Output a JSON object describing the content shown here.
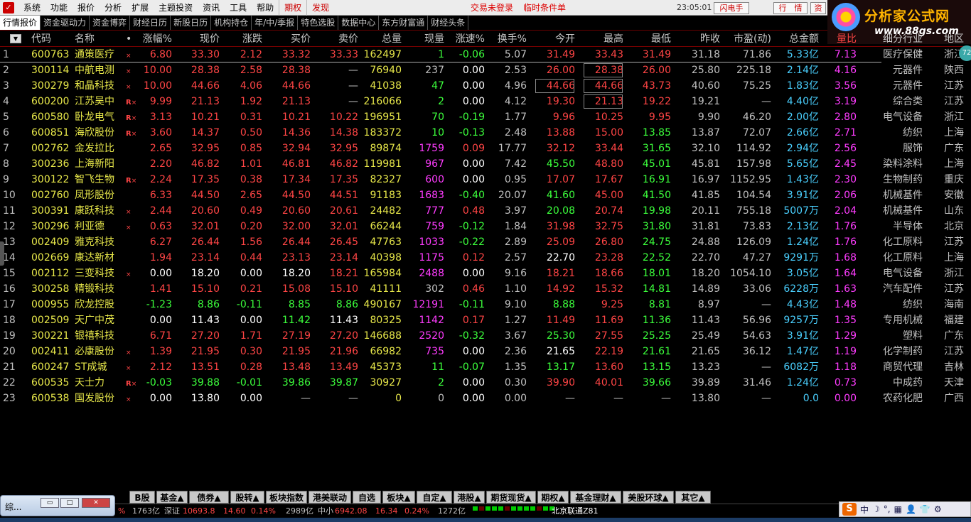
{
  "menubar": {
    "app_icon": "app-logo-icon",
    "items": [
      "系统",
      "功能",
      "报价",
      "分析",
      "扩展",
      "主题投资",
      "资讯",
      "工具",
      "帮助",
      "期权",
      "发现"
    ],
    "accent_items": [
      "期权",
      "发现"
    ],
    "login_status": "交易未登录",
    "conditional_order": "临时条件单",
    "clock": "23:05:01 周五",
    "btn_flash": "闪电手",
    "btn_quote": "行　情",
    "btn_asset": "资"
  },
  "logo": {
    "title": "分析家公式网",
    "url": "www.88gs.com",
    "badge": "72"
  },
  "tabs": [
    "行情报价",
    "资金驱动力",
    "资金博弈",
    "财经日历",
    "新股日历",
    "机构持仓",
    "年/中/季报",
    "特色选股",
    "数据中心",
    "东方财富通",
    "财经头条"
  ],
  "table": {
    "headers": [
      "代码",
      "名称",
      "•",
      "涨幅%",
      "现价",
      "涨跌",
      "买价",
      "卖价",
      "总量",
      "现量",
      "涨速%",
      "换手%",
      "今开",
      "最高",
      "最低",
      "昨收",
      "市盈(动)",
      "总金额",
      "量比",
      "细分行业",
      "地区"
    ],
    "rows": [
      {
        "n": "1",
        "code": "600763",
        "name": "通策医疗",
        "flag": "×",
        "pct": "6.80",
        "price": "33.30",
        "chg": "2.12",
        "bid": "33.32",
        "ask": "33.33",
        "vol": "162497",
        "cur": "1",
        "speed": "-0.06",
        "turn": "5.07",
        "open": "31.49",
        "high": "33.43",
        "low": "31.49",
        "prev": "31.18",
        "pe": "71.86",
        "amt": "5.33亿",
        "ratio": "7.13",
        "ind": "医疗保健",
        "area": "浙江"
      },
      {
        "n": "2",
        "code": "300114",
        "name": "中航电测",
        "flag": "×",
        "pct": "10.00",
        "price": "28.38",
        "chg": "2.58",
        "bid": "28.38",
        "ask": "—",
        "vol": "76940",
        "cur": "237",
        "speed": "0.00",
        "turn": "2.53",
        "open": "26.00",
        "high": "28.38",
        "low": "26.00",
        "prev": "25.80",
        "pe": "225.18",
        "amt": "2.14亿",
        "ratio": "4.16",
        "ind": "元器件",
        "area": "陕西"
      },
      {
        "n": "3",
        "code": "300279",
        "name": "和晶科技",
        "flag": "×",
        "pct": "10.00",
        "price": "44.66",
        "chg": "4.06",
        "bid": "44.66",
        "ask": "—",
        "vol": "41038",
        "cur": "47",
        "speed": "0.00",
        "turn": "4.96",
        "open": "44.66",
        "high": "44.66",
        "low": "43.73",
        "prev": "40.60",
        "pe": "75.25",
        "amt": "1.83亿",
        "ratio": "3.56",
        "ind": "元器件",
        "area": "江苏"
      },
      {
        "n": "4",
        "code": "600200",
        "name": "江苏吴中",
        "flag": "R×",
        "pct": "9.99",
        "price": "21.13",
        "chg": "1.92",
        "bid": "21.13",
        "ask": "—",
        "vol": "216066",
        "cur": "2",
        "speed": "0.00",
        "turn": "4.12",
        "open": "19.30",
        "high": "21.13",
        "low": "19.22",
        "prev": "19.21",
        "pe": "—",
        "amt": "4.40亿",
        "ratio": "3.19",
        "ind": "综合类",
        "area": "江苏"
      },
      {
        "n": "5",
        "code": "600580",
        "name": "卧龙电气",
        "flag": "R×",
        "pct": "3.13",
        "price": "10.21",
        "chg": "0.31",
        "bid": "10.21",
        "ask": "10.22",
        "vol": "196951",
        "cur": "70",
        "speed": "-0.19",
        "turn": "1.77",
        "open": "9.96",
        "high": "10.25",
        "low": "9.95",
        "prev": "9.90",
        "pe": "46.20",
        "amt": "2.00亿",
        "ratio": "2.80",
        "ind": "电气设备",
        "area": "浙江"
      },
      {
        "n": "6",
        "code": "600851",
        "name": "海欣股份",
        "flag": "R×",
        "pct": "3.60",
        "price": "14.37",
        "chg": "0.50",
        "bid": "14.36",
        "ask": "14.38",
        "vol": "183372",
        "cur": "10",
        "speed": "-0.13",
        "turn": "2.48",
        "open": "13.88",
        "high": "15.00",
        "low": "13.85",
        "prev": "13.87",
        "pe": "72.07",
        "amt": "2.66亿",
        "ratio": "2.71",
        "ind": "纺织",
        "area": "上海"
      },
      {
        "n": "7",
        "code": "002762",
        "name": "金发拉比",
        "flag": "",
        "pct": "2.65",
        "price": "32.95",
        "chg": "0.85",
        "bid": "32.94",
        "ask": "32.95",
        "vol": "89874",
        "cur": "1759",
        "speed": "0.09",
        "turn": "17.77",
        "open": "32.12",
        "high": "33.44",
        "low": "31.65",
        "prev": "32.10",
        "pe": "114.92",
        "amt": "2.94亿",
        "ratio": "2.56",
        "ind": "服饰",
        "area": "广东"
      },
      {
        "n": "8",
        "code": "300236",
        "name": "上海新阳",
        "flag": "",
        "pct": "2.20",
        "price": "46.82",
        "chg": "1.01",
        "bid": "46.81",
        "ask": "46.82",
        "vol": "119981",
        "cur": "967",
        "speed": "0.00",
        "turn": "7.42",
        "open": "45.50",
        "high": "48.80",
        "low": "45.01",
        "prev": "45.81",
        "pe": "157.98",
        "amt": "5.65亿",
        "ratio": "2.45",
        "ind": "染料涂料",
        "area": "上海"
      },
      {
        "n": "9",
        "code": "300122",
        "name": "智飞生物",
        "flag": "R×",
        "pct": "2.24",
        "price": "17.35",
        "chg": "0.38",
        "bid": "17.34",
        "ask": "17.35",
        "vol": "82327",
        "cur": "600",
        "speed": "0.00",
        "turn": "0.95",
        "open": "17.07",
        "high": "17.67",
        "low": "16.91",
        "prev": "16.97",
        "pe": "1152.95",
        "amt": "1.43亿",
        "ratio": "2.30",
        "ind": "生物制药",
        "area": "重庆"
      },
      {
        "n": "10",
        "code": "002760",
        "name": "凤形股份",
        "flag": "",
        "pct": "6.33",
        "price": "44.50",
        "chg": "2.65",
        "bid": "44.50",
        "ask": "44.51",
        "vol": "91183",
        "cur": "1683",
        "speed": "-0.40",
        "turn": "20.07",
        "open": "41.60",
        "high": "45.00",
        "low": "41.50",
        "prev": "41.85",
        "pe": "104.54",
        "amt": "3.91亿",
        "ratio": "2.06",
        "ind": "机械基件",
        "area": "安徽"
      },
      {
        "n": "11",
        "code": "300391",
        "name": "康跃科技",
        "flag": "×",
        "pct": "2.44",
        "price": "20.60",
        "chg": "0.49",
        "bid": "20.60",
        "ask": "20.61",
        "vol": "24482",
        "cur": "777",
        "speed": "0.48",
        "turn": "3.97",
        "open": "20.08",
        "high": "20.74",
        "low": "19.98",
        "prev": "20.11",
        "pe": "755.18",
        "amt": "5007万",
        "ratio": "2.04",
        "ind": "机械基件",
        "area": "山东"
      },
      {
        "n": "12",
        "code": "300296",
        "name": "利亚德",
        "flag": "×",
        "pct": "0.63",
        "price": "32.01",
        "chg": "0.20",
        "bid": "32.00",
        "ask": "32.01",
        "vol": "66244",
        "cur": "759",
        "speed": "-0.12",
        "turn": "1.84",
        "open": "31.98",
        "high": "32.75",
        "low": "31.80",
        "prev": "31.81",
        "pe": "73.83",
        "amt": "2.13亿",
        "ratio": "1.76",
        "ind": "半导体",
        "area": "北京"
      },
      {
        "n": "13",
        "code": "002409",
        "name": "雅克科技",
        "flag": "",
        "pct": "6.27",
        "price": "26.44",
        "chg": "1.56",
        "bid": "26.44",
        "ask": "26.45",
        "vol": "47763",
        "cur": "1033",
        "speed": "-0.22",
        "turn": "2.89",
        "open": "25.09",
        "high": "26.80",
        "low": "24.75",
        "prev": "24.88",
        "pe": "126.09",
        "amt": "1.24亿",
        "ratio": "1.76",
        "ind": "化工原料",
        "area": "江苏"
      },
      {
        "n": "14",
        "code": "002669",
        "name": "康达新材",
        "flag": "",
        "pct": "1.94",
        "price": "23.14",
        "chg": "0.44",
        "bid": "23.13",
        "ask": "23.14",
        "vol": "40398",
        "cur": "1175",
        "speed": "0.12",
        "turn": "2.57",
        "open": "22.70",
        "high": "23.28",
        "low": "22.52",
        "prev": "22.70",
        "pe": "47.27",
        "amt": "9291万",
        "ratio": "1.68",
        "ind": "化工原料",
        "area": "上海"
      },
      {
        "n": "15",
        "code": "002112",
        "name": "三变科技",
        "flag": "×",
        "pct": "0.00",
        "price": "18.20",
        "chg": "0.00",
        "bid": "18.20",
        "ask": "18.21",
        "vol": "165984",
        "cur": "2488",
        "speed": "0.00",
        "turn": "9.16",
        "open": "18.21",
        "high": "18.66",
        "low": "18.01",
        "prev": "18.20",
        "pe": "1054.10",
        "amt": "3.05亿",
        "ratio": "1.64",
        "ind": "电气设备",
        "area": "浙江"
      },
      {
        "n": "16",
        "code": "300258",
        "name": "精锻科技",
        "flag": "",
        "pct": "1.41",
        "price": "15.10",
        "chg": "0.21",
        "bid": "15.08",
        "ask": "15.10",
        "vol": "41111",
        "cur": "302",
        "speed": "0.46",
        "turn": "1.10",
        "open": "14.92",
        "high": "15.32",
        "low": "14.81",
        "prev": "14.89",
        "pe": "33.06",
        "amt": "6228万",
        "ratio": "1.63",
        "ind": "汽车配件",
        "area": "江苏"
      },
      {
        "n": "17",
        "code": "000955",
        "name": "欣龙控股",
        "flag": "",
        "pct": "-1.23",
        "price": "8.86",
        "chg": "-0.11",
        "bid": "8.85",
        "ask": "8.86",
        "vol": "490167",
        "cur": "12191",
        "speed": "-0.11",
        "turn": "9.10",
        "open": "8.88",
        "high": "9.25",
        "low": "8.81",
        "prev": "8.97",
        "pe": "—",
        "amt": "4.43亿",
        "ratio": "1.48",
        "ind": "纺织",
        "area": "海南"
      },
      {
        "n": "18",
        "code": "002509",
        "name": "天广中茂",
        "flag": "",
        "pct": "0.00",
        "price": "11.43",
        "chg": "0.00",
        "bid": "11.42",
        "ask": "11.43",
        "vol": "80325",
        "cur": "1142",
        "speed": "0.17",
        "turn": "1.27",
        "open": "11.49",
        "high": "11.69",
        "low": "11.36",
        "prev": "11.43",
        "pe": "56.96",
        "amt": "9257万",
        "ratio": "1.35",
        "ind": "专用机械",
        "area": "福建"
      },
      {
        "n": "19",
        "code": "300221",
        "name": "银禧科技",
        "flag": "",
        "pct": "6.71",
        "price": "27.20",
        "chg": "1.71",
        "bid": "27.19",
        "ask": "27.20",
        "vol": "146688",
        "cur": "2520",
        "speed": "-0.32",
        "turn": "3.67",
        "open": "25.30",
        "high": "27.55",
        "low": "25.25",
        "prev": "25.49",
        "pe": "54.63",
        "amt": "3.91亿",
        "ratio": "1.29",
        "ind": "塑料",
        "area": "广东"
      },
      {
        "n": "20",
        "code": "002411",
        "name": "必康股份",
        "flag": "×",
        "pct": "1.39",
        "price": "21.95",
        "chg": "0.30",
        "bid": "21.95",
        "ask": "21.96",
        "vol": "66982",
        "cur": "735",
        "speed": "0.00",
        "turn": "2.36",
        "open": "21.65",
        "high": "22.19",
        "low": "21.61",
        "prev": "21.65",
        "pe": "36.12",
        "amt": "1.47亿",
        "ratio": "1.19",
        "ind": "化学制药",
        "area": "江苏"
      },
      {
        "n": "21",
        "code": "600247",
        "name": "ST成城",
        "flag": "×",
        "pct": "2.12",
        "price": "13.51",
        "chg": "0.28",
        "bid": "13.48",
        "ask": "13.49",
        "vol": "45373",
        "cur": "11",
        "speed": "-0.07",
        "turn": "1.35",
        "open": "13.17",
        "high": "13.60",
        "low": "13.15",
        "prev": "13.23",
        "pe": "—",
        "amt": "6082万",
        "ratio": "1.18",
        "ind": "商贸代理",
        "area": "吉林"
      },
      {
        "n": "22",
        "code": "600535",
        "name": "天士力",
        "flag": "R×",
        "pct": "-0.03",
        "price": "39.88",
        "chg": "-0.01",
        "bid": "39.86",
        "ask": "39.87",
        "vol": "30927",
        "cur": "2",
        "speed": "0.00",
        "turn": "0.30",
        "open": "39.90",
        "high": "40.01",
        "low": "39.66",
        "prev": "39.89",
        "pe": "31.46",
        "amt": "1.24亿",
        "ratio": "0.73",
        "ind": "中成药",
        "area": "天津"
      },
      {
        "n": "23",
        "code": "600538",
        "name": "国发股份",
        "flag": "×",
        "pct": "0.00",
        "price": "13.80",
        "chg": "0.00",
        "bid": "—",
        "ask": "—",
        "vol": "0",
        "cur": "0",
        "speed": "0.00",
        "turn": "0.00",
        "open": "—",
        "high": "—",
        "low": "—",
        "prev": "13.80",
        "pe": "—",
        "amt": "0.0",
        "ratio": "0.00",
        "ind": "农药化肥",
        "area": "广西"
      }
    ]
  },
  "categories": [
    "B股",
    "基金▲",
    "债券▲",
    "股转▲",
    "板块指数",
    "港美联动",
    "自选",
    "板块▲",
    "自定▲",
    "港股▲",
    "期货现货▲",
    "期权▲",
    "基金理财▲",
    "美股环球▲",
    "其它▲"
  ],
  "status": {
    "sh_amount": "1763亿",
    "sz_label": "深证",
    "sz_index": "10693.8",
    "sz_change": "14.60",
    "sz_pct": "0.14%",
    "sz_amount": "2989亿",
    "sme_label": "中小",
    "sme_index": "6942.08",
    "sme_change": "16.34",
    "sme_pct": "0.24%",
    "sme_amount": "1272亿",
    "server": "北京联通Z81",
    "left_pct": "%"
  },
  "mini_window": {
    "title": "综..."
  },
  "tray": {
    "items": [
      "中",
      "☽",
      "°,",
      "▦",
      "👤",
      "👕",
      "⚙"
    ]
  },
  "colors": {
    "up": "#ff4545",
    "down": "#3cff3c",
    "flat": "#ffffff",
    "volume": "#e8e84a",
    "current_volume": "#ff3cff",
    "amount": "#4ad0ff",
    "background": "#000000"
  }
}
